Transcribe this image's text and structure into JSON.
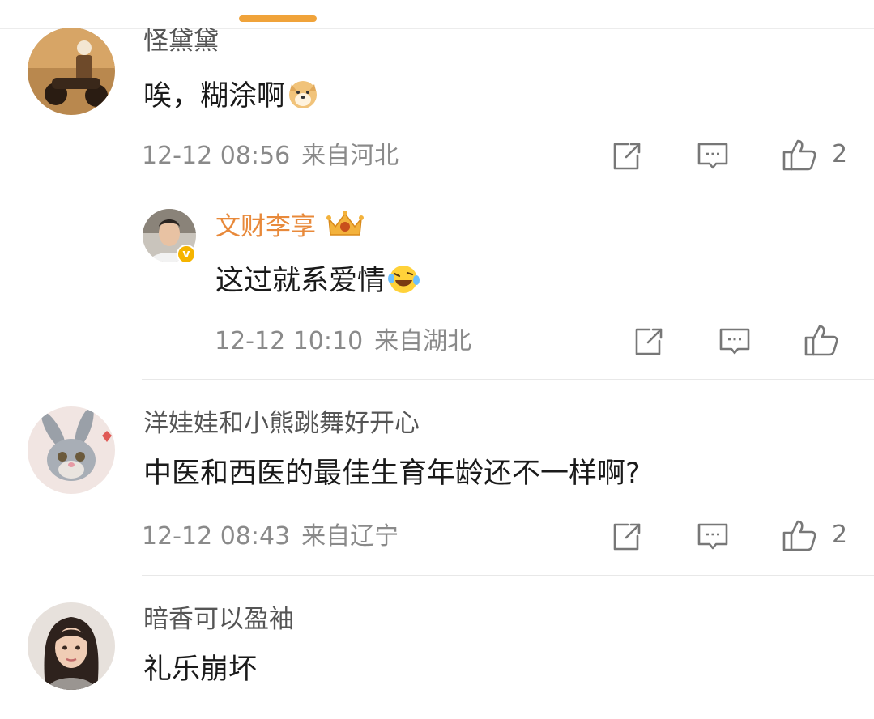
{
  "comments": [
    {
      "username": "怪黛黛",
      "text": "唉，糊涂啊",
      "emoji": "doge-emoji",
      "time": "12-12 08:56",
      "location": "来自河北",
      "likes": "2",
      "reply": {
        "username": "文财李享",
        "text": "这过就系爱情",
        "emoji": "laugh-cry-emoji",
        "time": "12-12 10:10",
        "location": "来自湖北",
        "likes": ""
      }
    },
    {
      "username": "洋娃娃和小熊跳舞好开心",
      "text": "中医和西医的最佳生育年龄还不一样啊?",
      "time": "12-12 08:43",
      "location": "来自辽宁",
      "likes": "2"
    },
    {
      "username": "暗香可以盈袖",
      "text": "礼乐崩坏"
    }
  ],
  "colors": {
    "accent": "#f0a33a",
    "vip_name": "#e8893a",
    "meta_text": "#8a8a8a"
  },
  "icons": [
    "share-icon",
    "comment-icon",
    "like-icon",
    "verified-badge-icon",
    "crown-icon"
  ]
}
